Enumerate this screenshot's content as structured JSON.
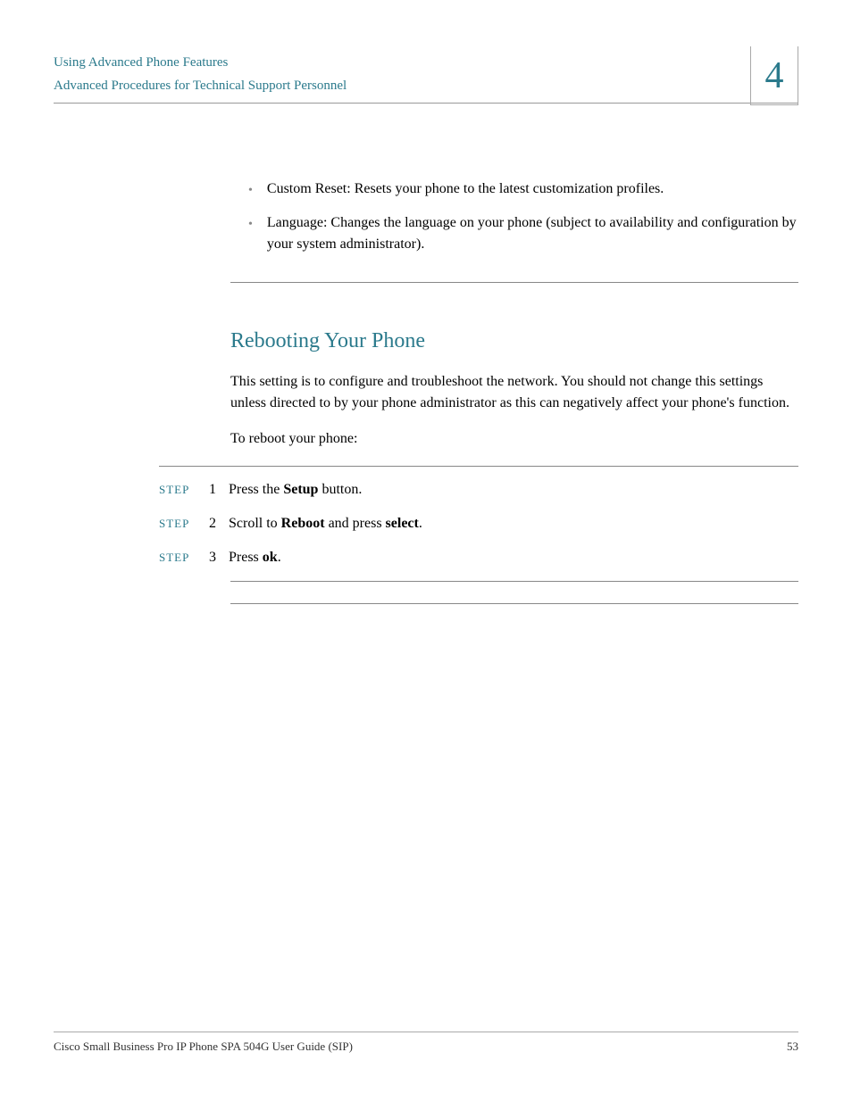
{
  "header": {
    "title": "Using Advanced Phone Features",
    "subtitle": "Advanced Procedures for Technical Support Personnel",
    "chapter": "4"
  },
  "bullets": [
    "Custom Reset: Resets your phone to the latest customization profiles.",
    "Language: Changes the language on your phone (subject to availability and configuration by your system administrator)."
  ],
  "section": {
    "heading": "Rebooting Your Phone",
    "intro": "This setting is to configure and troubleshoot the network. You should not change this settings unless directed to by your phone administrator as this can negatively affect your phone's function.",
    "lead": "To reboot your phone:"
  },
  "step_label": "STEP",
  "steps": [
    {
      "num": "1",
      "prefix": "Press the ",
      "bold1": "Setup",
      "mid": " button.",
      "bold2": "",
      "suffix": ""
    },
    {
      "num": "2",
      "prefix": "Scroll to ",
      "bold1": "Reboot",
      "mid": " and press ",
      "bold2": "select",
      "suffix": "."
    },
    {
      "num": "3",
      "prefix": "Press ",
      "bold1": "ok",
      "mid": ".",
      "bold2": "",
      "suffix": ""
    }
  ],
  "footer": {
    "left": "Cisco Small Business Pro IP Phone SPA 504G User Guide (SIP)",
    "right": "53"
  }
}
